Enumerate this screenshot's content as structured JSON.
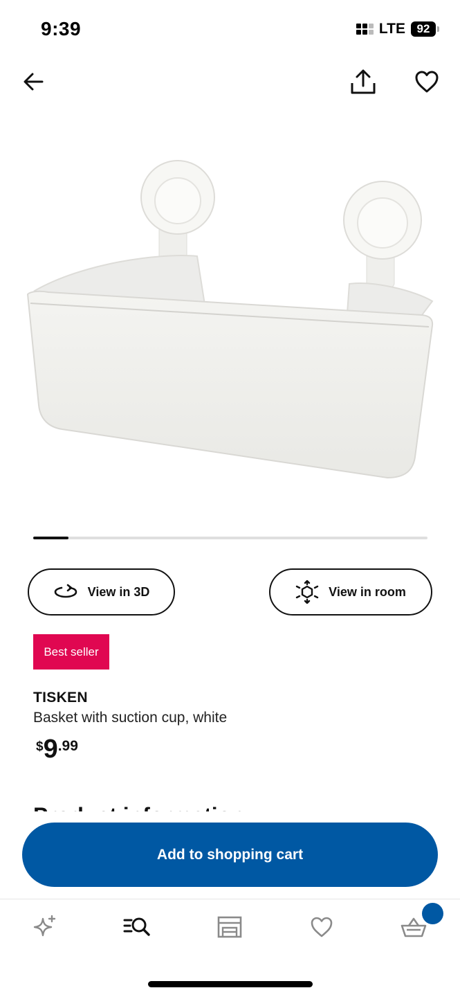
{
  "status": {
    "time": "9:39",
    "network": "LTE",
    "battery": "92"
  },
  "nav": {
    "back_icon": "arrow-left-icon",
    "share_icon": "share-icon",
    "favorite_icon": "heart-icon"
  },
  "carousel": {
    "progress_fraction": 0.09
  },
  "actions": {
    "view_3d_label": "View in 3D",
    "view_room_label": "View in room"
  },
  "product": {
    "badge": "Best seller",
    "name": "TISKEN",
    "description": "Basket with suction cup, white",
    "price": {
      "currency": "$",
      "integer": "9",
      "decimal": ".99"
    }
  },
  "section": {
    "title": "Product information"
  },
  "cart": {
    "button_label": "Add to shopping cart"
  },
  "tabs": [
    {
      "name": "inspiration",
      "icon": "sparkle-icon"
    },
    {
      "name": "search",
      "icon": "search-list-icon"
    },
    {
      "name": "stores",
      "icon": "store-icon"
    },
    {
      "name": "favorites",
      "icon": "heart-icon"
    },
    {
      "name": "cart",
      "icon": "basket-icon"
    }
  ],
  "colors": {
    "brand_blue": "#0058a3",
    "badge_red": "#e00751"
  }
}
